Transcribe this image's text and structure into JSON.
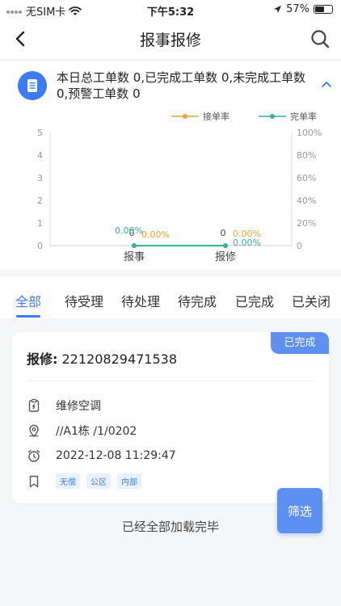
{
  "status_bar": {
    "carrier": "无SIM卡",
    "time": "下午5:32",
    "battery": "57%",
    "battery_level": 0.57
  },
  "nav": {
    "title": "报事报修"
  },
  "summary": {
    "text": "本日总工单数 0,已完成工单数 0,未完成工单数 0,预警工单数 0"
  },
  "chart_data": {
    "type": "line",
    "categories": [
      "报事",
      "报修"
    ],
    "series": [
      {
        "name": "接单率",
        "color": "#f0a23a",
        "values": [
          0,
          0
        ],
        "labels": [
          "0.00%",
          "0.00%"
        ]
      },
      {
        "name": "完单率",
        "color": "#34b29a",
        "values": [
          0,
          0
        ],
        "labels": [
          "0.00%",
          "0.00%"
        ]
      }
    ],
    "bar_labels": [
      "0",
      "0"
    ],
    "yleft_ticks": [
      "5",
      "4",
      "3",
      "2",
      "1",
      "0"
    ],
    "yright_ticks": [
      "100%",
      "80%",
      "60%",
      "40%",
      "20%",
      "0"
    ],
    "ylim_left": [
      0,
      5
    ],
    "ylim_right": [
      0,
      100
    ],
    "legend": "top-right"
  },
  "tabs": [
    "全部",
    "待受理",
    "待处理",
    "待完成",
    "已完成",
    "已关闭"
  ],
  "order": {
    "badge": "已完成",
    "no_label": "报修:",
    "no_value": "22120829471538",
    "category": "维修空调",
    "location": "//A1栋 /1/0202",
    "time": "2022-12-08 11:29:47",
    "tags": [
      "无偿",
      "公区",
      "内部"
    ]
  },
  "filter_label": "筛选",
  "footer_text": "已经全部加载完毕"
}
